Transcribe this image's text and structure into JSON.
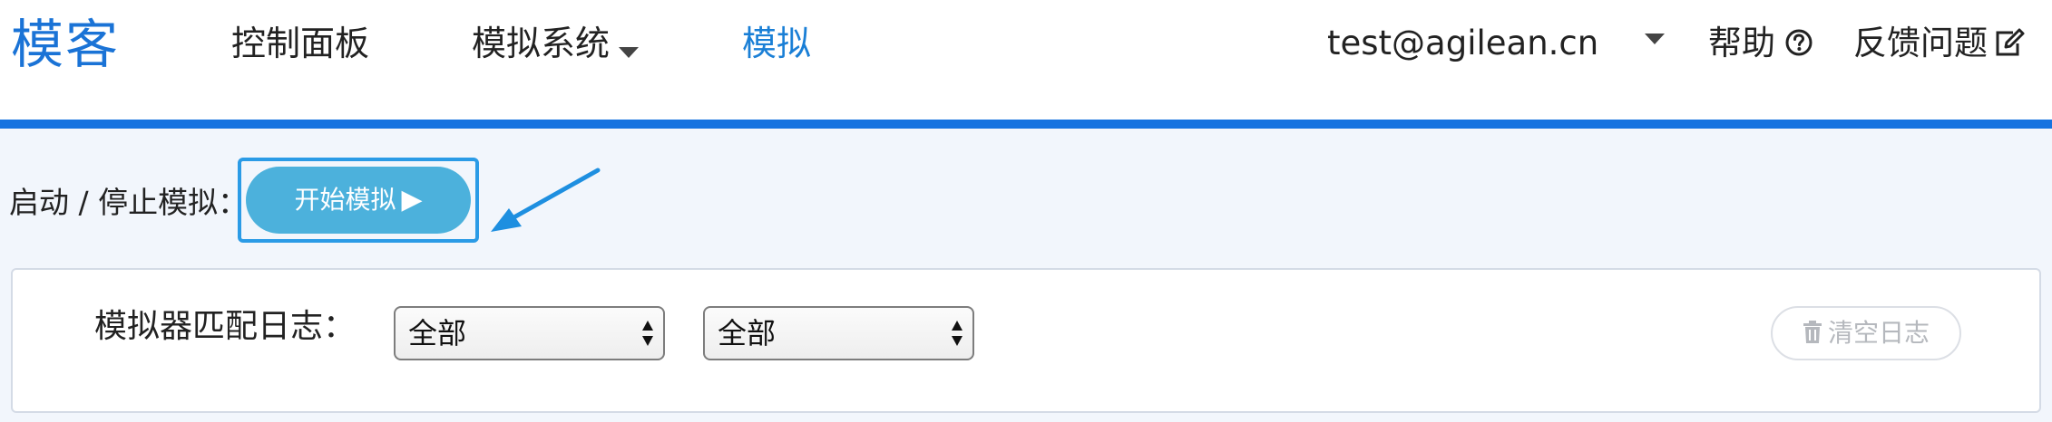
{
  "header": {
    "brand": "模客",
    "nav": {
      "dashboard": "控制面板",
      "system": "模拟系统",
      "simulate": "模拟"
    },
    "user_email": "test@agilean.cn",
    "help_label": "帮助",
    "feedback_label": "反馈问题"
  },
  "simulation": {
    "control_label": "启动 / 停止模拟：",
    "start_button_label": "开始模拟",
    "start_button_icon": "▶"
  },
  "log": {
    "label": "模拟器匹配日志：",
    "filter1_value": "全部",
    "filter2_value": "全部",
    "clear_button_label": "清空日志",
    "clear_button_icon": "trash-icon"
  },
  "colors": {
    "brand": "#1a73d6",
    "active_nav": "#1a7fd6",
    "accent_bar": "#1673e0",
    "start_button": "#4cb1dc",
    "highlight_border": "#2b9be6"
  }
}
